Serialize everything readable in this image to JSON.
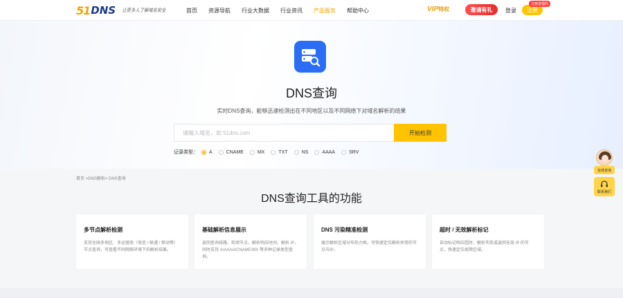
{
  "nav": {
    "logo_51": "51",
    "logo_dns": "DNS",
    "slogan": "让更多人了解域名安全",
    "links": [
      "首页",
      "资源导航",
      "行业大数据",
      "行业资讯",
      "产品服务",
      "帮助中心"
    ],
    "active_link": "产品服务",
    "vip_text": "VIP",
    "vip_suffix": "特权",
    "promo": "邀请有礼",
    "login": "登录",
    "register": "注册",
    "register_badge": "注册送福利"
  },
  "hero": {
    "title": "DNS查询",
    "description": "实时DNS查询，能够迅速检测出在不同地区以及不同网络下对域名解析的结果",
    "search_placeholder": "请输入域名，如 51dns.com",
    "search_button": "开始检测",
    "record_type_label": "记录类型：",
    "record_types": [
      "A",
      "CNAME",
      "MX",
      "TXT",
      "NS",
      "AAAA",
      "SRV"
    ],
    "selected_record_type": "A"
  },
  "breadcrumb": "首页 >DNS解析> DNS查询",
  "features": {
    "title": "DNS查询工具的功能",
    "cards": [
      {
        "title": "多节点解析检测",
        "desc": "支持全国多地区、多运营商（电信 / 联通 / 移动等）节点查询，可查看不同网络环境下的解析结果。"
      },
      {
        "title": "基础解析信息展示",
        "desc": "返回查询线路、检测节点、解析响应时间、解析 IP，同时支持 A/AAAA/CNAME/MX 等多种记录类型查询。"
      },
      {
        "title": "DNS 污染精准检测",
        "desc": "展示解析区域分布热力图，可快速定位解析异常的节点与IP。"
      },
      {
        "title": "超时 / 无效解析标记",
        "desc": "自动标记响应超时、解析失败或返回无效 IP 的节点，快速定位故障区域。"
      }
    ]
  },
  "float": {
    "consult": "在线咨询",
    "contact": "联系我们"
  },
  "colors": {
    "accent": "#ffc300",
    "brand_blue": "#2b6ef5",
    "promo_red": "#e52d2d"
  }
}
